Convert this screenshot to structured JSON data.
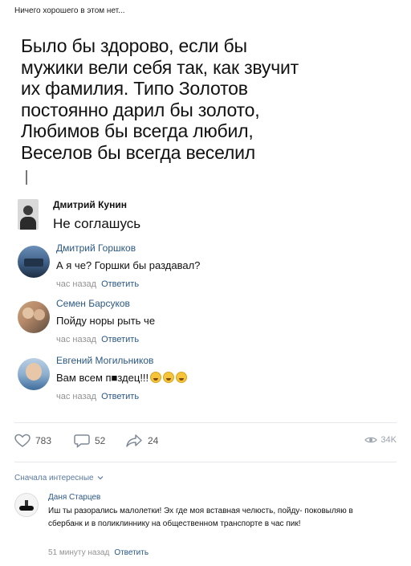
{
  "caption": "Ничего хорошего в этом нет...",
  "post": {
    "lines": [
      "Было бы здорово, если бы",
      "мужики вели себя так, как звучит",
      "их фамилия. Типо Золотов",
      "постоянно дарил бы золото,",
      "Любимов бы всегда любил,",
      "Веселов бы всегда веселил"
    ]
  },
  "first_comment": {
    "author": "Дмитрий Кунин",
    "text": "Не соглашусь"
  },
  "comments": [
    {
      "author": "Дмитрий Горшков",
      "text": "А я че? Горшки бы раздавал?",
      "time": "час назад",
      "reply": "Ответить"
    },
    {
      "author": "Семен Барсуков",
      "text": "Пойду норы рыть че",
      "time": "час назад",
      "reply": "Ответить"
    },
    {
      "author": "Евгений Могильников",
      "text": "Вам всем п■здец!!!",
      "time": "час назад",
      "reply": "Ответить",
      "emoji_icons": [
        "grinning-face-icon",
        "grinning-face-icon",
        "grinning-face-icon"
      ]
    }
  ],
  "actions": {
    "likes": "783",
    "comments": "52",
    "shares": "24",
    "views": "34K",
    "icons": [
      "heart-icon",
      "comment-icon",
      "share-icon",
      "eye-icon"
    ]
  },
  "sort_label": "Сначала интересные",
  "reply": {
    "author": "Даня Старцев",
    "text": "Иш ты разорались малолетки! Эх где моя вставная челюсть, пойду- поковыляю в сбербанк и в поликлиннику на общественном транспорте в час пик!",
    "time": "51 минуту назад",
    "reply": "Ответить"
  },
  "colors": {
    "link": "#2a5885",
    "meta": "#939393",
    "divider": "#e7e8ec"
  }
}
